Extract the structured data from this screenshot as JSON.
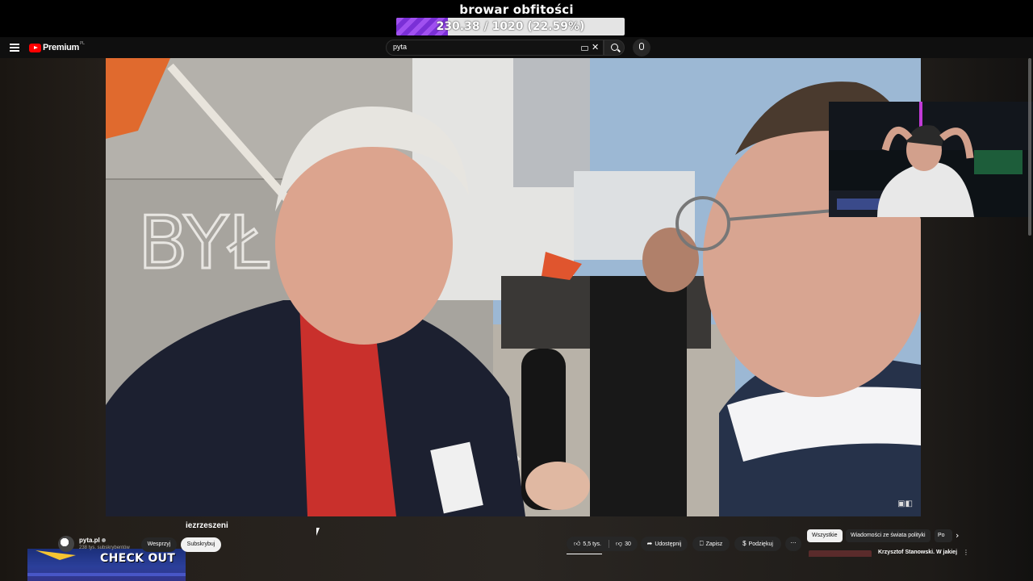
{
  "overlay": {
    "goal_title": "browar obfitości",
    "goal_progress_text": "230.38 / 1020 (22.59%)",
    "goal_fraction": 0.2259,
    "goal_fill_color": "#8a3be6",
    "badge_text": "CHECK OUT"
  },
  "youtube": {
    "logo_text": "Premium",
    "logo_sup": "PL",
    "search": {
      "value": "pyta"
    }
  },
  "video": {
    "title_fragment": "iezrzeszeni"
  },
  "channel": {
    "name": "pyta.pl",
    "subscribers": "238 tys. subskrybentów",
    "support_label": "Wesprzyj",
    "subscribe_label": "Subskrybuj"
  },
  "actions": {
    "likes": "5,5 tys.",
    "dislikes": "30",
    "share_label": "Udostępnij",
    "save_label": "Zapisz",
    "thanks_label": "Podziękuj",
    "more_label": "⋯"
  },
  "chips": {
    "items": [
      "Wszystkie",
      "Wiadomości ze świata polityki",
      "Po"
    ]
  },
  "recommendation": {
    "title": "Krzysztof Stanowski. W jakiej"
  }
}
